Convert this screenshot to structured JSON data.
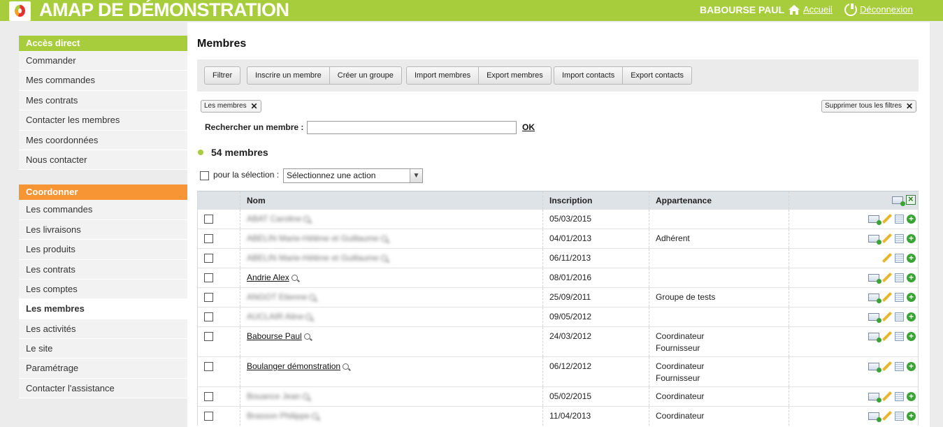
{
  "header": {
    "app_title": "AMAP DE DÉMONSTRATION",
    "user_name": "BABOURSE PAUL",
    "home_label": "Accueil",
    "logout_label": "Déconnexion"
  },
  "sidebar": {
    "direct_title": "Accès direct",
    "direct_items": [
      "Commander",
      "Mes commandes",
      "Mes contrats",
      "Contacter les membres",
      "Mes coordonnées",
      "Nous contacter"
    ],
    "coord_title": "Coordonner",
    "coord_items": [
      "Les commandes",
      "Les livraisons",
      "Les produits",
      "Les contrats",
      "Les comptes",
      "Les membres",
      "Les activités",
      "Le site",
      "Paramétrage",
      "Contacter l'assistance"
    ],
    "active_item": "Les membres"
  },
  "main": {
    "title": "Membres",
    "buttons": {
      "filter": "Filtrer",
      "register": "Inscrire un membre",
      "create_group": "Créer un groupe",
      "import_members": "Import membres",
      "export_members": "Export membres",
      "import_contacts": "Import contacts",
      "export_contacts": "Export contacts"
    },
    "filter_chip": "Les membres",
    "clear_filters": "Supprimer tous les filtres",
    "search_label": "Rechercher un membre :",
    "search_value": "",
    "ok_label": "OK",
    "count_label": "54 membres",
    "selection_label": "pour la sélection :",
    "action_select": "Sélectionnez une action"
  },
  "table": {
    "headers": {
      "name": "Nom",
      "registration": "Inscription",
      "membership": "Appartenance"
    },
    "rows": [
      {
        "name": "ABAT Caroline",
        "blurred": true,
        "date": "05/03/2015",
        "groups": [],
        "mail": true
      },
      {
        "name": "ABELIN Marie-Hélène et Guillaume",
        "blurred": true,
        "date": "04/01/2013",
        "groups": [
          "Adhérent"
        ],
        "mail": true
      },
      {
        "name": "ABELIN Marie-Hélène et Guillaume",
        "blurred": true,
        "date": "06/11/2013",
        "groups": [],
        "mail": false
      },
      {
        "name": "Andrie Alex",
        "blurred": false,
        "date": "08/01/2016",
        "groups": [],
        "mail": true
      },
      {
        "name": "ANGOT Etienne",
        "blurred": true,
        "date": "25/09/2011",
        "groups": [
          "Groupe de tests"
        ],
        "mail": true
      },
      {
        "name": "AUCLAIR Aline",
        "blurred": true,
        "date": "09/05/2012",
        "groups": [],
        "mail": true
      },
      {
        "name": "Babourse Paul",
        "blurred": false,
        "date": "24/03/2012",
        "groups": [
          "Coordinateur",
          "Fournisseur"
        ],
        "mail": true
      },
      {
        "name": "Boulanger démonstration",
        "blurred": false,
        "date": "06/12/2012",
        "groups": [
          "Coordinateur",
          "Fournisseur"
        ],
        "mail": true
      },
      {
        "name": "Bouance Jean",
        "blurred": true,
        "date": "05/02/2015",
        "groups": [
          "Coordinateur"
        ],
        "mail": true
      },
      {
        "name": "Brasson Philippe",
        "blurred": true,
        "date": "11/04/2013",
        "groups": [
          "Coordinateur"
        ],
        "mail": true
      }
    ]
  }
}
